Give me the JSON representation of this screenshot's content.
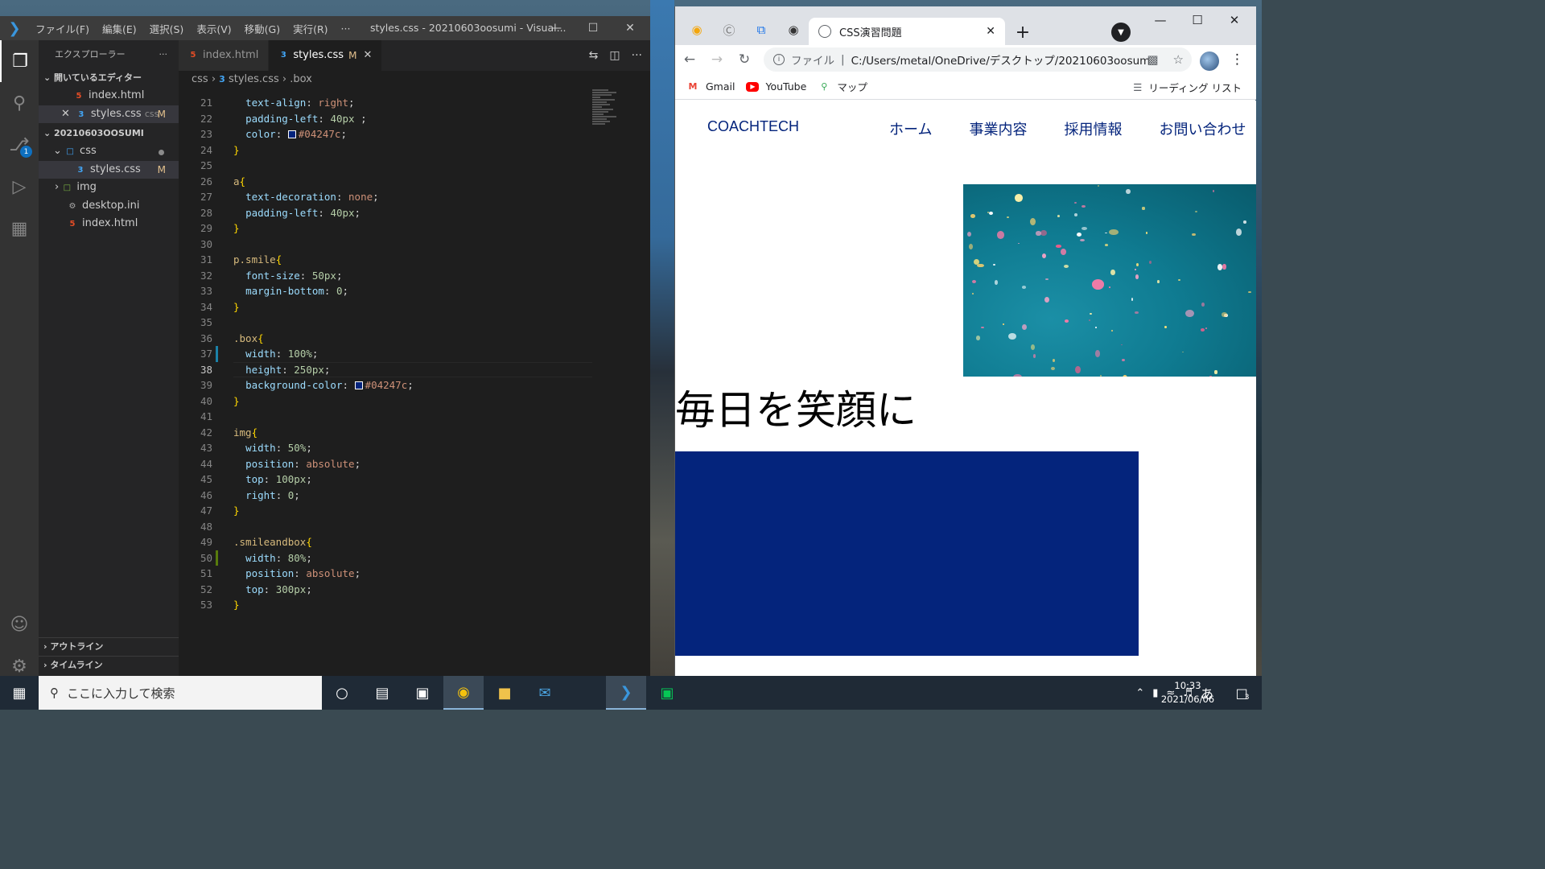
{
  "vscode": {
    "window_title": "styles.css - 20210603oosumi - Visual...",
    "menu": [
      "ファイル(F)",
      "編集(E)",
      "選択(S)",
      "表示(V)",
      "移動(G)",
      "実行(R)",
      "···"
    ],
    "explorer_title": "エクスプローラー",
    "open_editors_title": "開いているエディター",
    "open_editors": [
      {
        "name": "index.html",
        "type": "html",
        "mark": ""
      },
      {
        "name": "styles.css",
        "folder": "css",
        "type": "css",
        "mark": "M"
      }
    ],
    "workspace_title": "20210603OOSUMI",
    "tree": [
      {
        "name": "css",
        "kind": "folder"
      },
      {
        "name": "styles.css",
        "kind": "css",
        "mark": "M"
      },
      {
        "name": "img",
        "kind": "folder"
      },
      {
        "name": "desktop.ini",
        "kind": "ini"
      },
      {
        "name": "index.html",
        "kind": "html"
      }
    ],
    "outline": "アウトライン",
    "timeline": "タイムライン",
    "tabs": [
      {
        "label": "index.html",
        "active": false
      },
      {
        "label": "styles.css",
        "mark": "M",
        "active": true
      }
    ],
    "breadcrumb": [
      "css",
      "styles.css",
      ".box"
    ],
    "scm_badge": "1",
    "code": [
      {
        "n": "21",
        "t": "  text-align: right;"
      },
      {
        "n": "22",
        "t": "  padding-left: 40px ;"
      },
      {
        "n": "23",
        "t": "  color: #04247c;"
      },
      {
        "n": "24",
        "t": "}"
      },
      {
        "n": "25",
        "t": ""
      },
      {
        "n": "26",
        "t": "a{"
      },
      {
        "n": "27",
        "t": "  text-decoration: none;"
      },
      {
        "n": "28",
        "t": "  padding-left: 40px;"
      },
      {
        "n": "29",
        "t": "}"
      },
      {
        "n": "30",
        "t": ""
      },
      {
        "n": "31",
        "t": "p.smile{"
      },
      {
        "n": "32",
        "t": "  font-size: 50px;"
      },
      {
        "n": "33",
        "t": "  margin-bottom: 0;"
      },
      {
        "n": "34",
        "t": "}"
      },
      {
        "n": "35",
        "t": ""
      },
      {
        "n": "36",
        "t": ".box{"
      },
      {
        "n": "37",
        "t": "  width: 100%;"
      },
      {
        "n": "38",
        "t": "  height: 250px;"
      },
      {
        "n": "39",
        "t": "  background-color: #04247c;"
      },
      {
        "n": "40",
        "t": "}"
      },
      {
        "n": "41",
        "t": ""
      },
      {
        "n": "42",
        "t": "img{"
      },
      {
        "n": "43",
        "t": "  width: 50%;"
      },
      {
        "n": "44",
        "t": "  position: absolute;"
      },
      {
        "n": "45",
        "t": "  top: 100px;"
      },
      {
        "n": "46",
        "t": "  right: 0;"
      },
      {
        "n": "47",
        "t": "}"
      },
      {
        "n": "48",
        "t": ""
      },
      {
        "n": "49",
        "t": ".smileandbox{"
      },
      {
        "n": "50",
        "t": "  width: 80%;"
      },
      {
        "n": "51",
        "t": "  position: absolute;"
      },
      {
        "n": "52",
        "t": "  top: 300px;"
      },
      {
        "n": "53",
        "t": "}"
      }
    ],
    "current_line": "38"
  },
  "chrome": {
    "tab_title": "CSS演習問題",
    "omnibox_scheme": "ファイル",
    "omnibox_url": "C:/Users/metal/OneDrive/デスクトップ/20210603oosumi/i...",
    "bookmarks": [
      "Gmail",
      "YouTube",
      "マップ"
    ],
    "reading_list": "リーディング リスト"
  },
  "site": {
    "logo": "COACHTECH",
    "nav": [
      "ホーム",
      "事業内容",
      "採用情報",
      "お問い合わせ"
    ],
    "smile_text": "毎日を笑顔に",
    "box_color": "#04247c"
  },
  "taskbar": {
    "search_placeholder": "ここに入力して検索",
    "time": "10:33",
    "date": "2021/06/06",
    "ime": "あ",
    "notifications": "3"
  }
}
